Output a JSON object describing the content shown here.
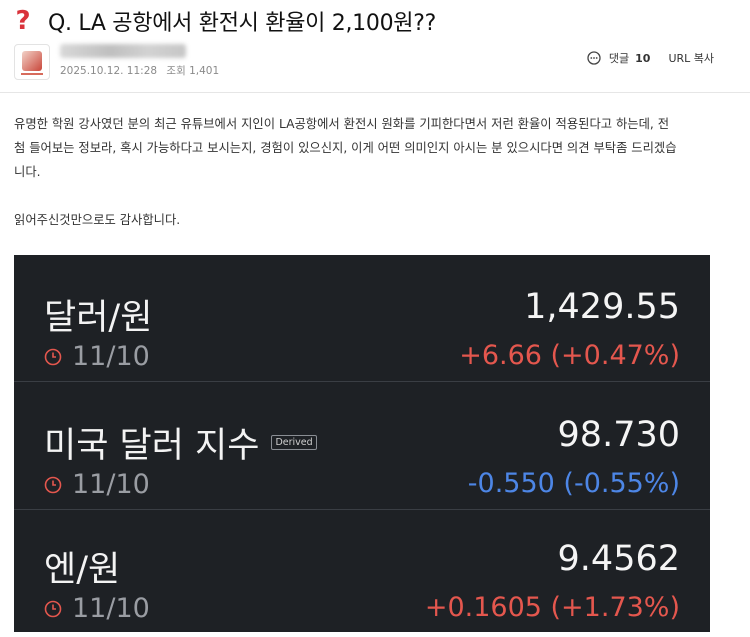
{
  "post": {
    "title": "Q. LA 공항에서 환전시 환율이 2,100원??",
    "date": "2025.10.12. 11:28",
    "views": "조회 1,401",
    "comment_label": "댓글",
    "comment_count": "10",
    "url_copy": "URL 복사",
    "body_line1": "유명한 학원 강사였던 분의 최근 유튜브에서 지인이 LA공항에서 환전시 원화를 기피한다면서 저런 환율이 적용된다고 하는데, 전",
    "body_line2": "첨 들어보는 정보라, 혹시 가능하다고 보시는지, 경험이 있으신지, 이게 어떤 의미인지 아시는 분 있으시다면 의견 부탁좀 드리겠습",
    "body_line3": "니다.",
    "body_line4": "읽어주신것만으로도 감사합니다."
  },
  "rates": [
    {
      "name": "달러/원",
      "date": "11/10",
      "price": "1,429.55",
      "change": "+6.66 (+0.47%)",
      "direction": "up",
      "badge": ""
    },
    {
      "name": "미국 달러 지수",
      "date": "11/10",
      "price": "98.730",
      "change": "-0.550 (-0.55%)",
      "direction": "down",
      "badge": "Derived"
    },
    {
      "name": "엔/원",
      "date": "11/10",
      "price": "9.4562",
      "change": "+0.1605 (+1.73%)",
      "direction": "up",
      "badge": ""
    }
  ],
  "colors": {
    "up": "#e4574e",
    "down": "#4d86e6",
    "panel": "#1e2125",
    "question_icon": "#d9323b"
  }
}
